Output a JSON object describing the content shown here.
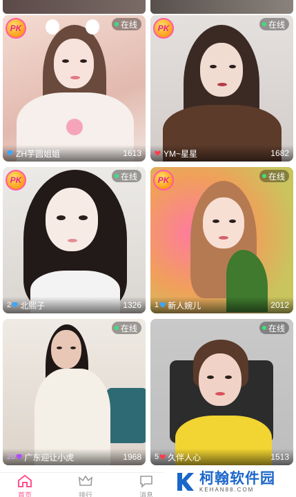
{
  "top_partial": {
    "left_text": "",
    "right_text": ""
  },
  "online_label": "在线",
  "pk_label": "PK",
  "cards": [
    {
      "name": "ZH芋圆姐姐",
      "level": "",
      "level_color": "#3aa7ff",
      "count": "1613",
      "pk": true,
      "bg": "#e7cdc6"
    },
    {
      "name": "YM~星星",
      "level": "",
      "level_color": "#ff3b4a",
      "count": "1682",
      "pk": true,
      "bg": "#d9d2cf"
    },
    {
      "name": "北熙子",
      "level": "2",
      "level_color": "#3aa7ff",
      "count": "1326",
      "pk": true,
      "bg": "#e9e6e2"
    },
    {
      "name": "新人婉儿",
      "level": "1",
      "level_color": "#3aa7ff",
      "count": "2012",
      "pk": true,
      "bg": "#f0a07a"
    },
    {
      "name": "广东迎让小虎",
      "level": "20",
      "level_color": "#b24dff",
      "count": "1968",
      "pk": false,
      "bg": "#e3dcd4"
    },
    {
      "name": "久伴人心",
      "level": "5",
      "level_color": "#ff3b4a",
      "count": "1513",
      "pk": false,
      "bg": "#cfcfcf"
    }
  ],
  "nav": [
    {
      "label": "首页",
      "icon": "home-icon"
    },
    {
      "label": "排行",
      "icon": "crown-icon"
    },
    {
      "label": "消息",
      "icon": "message-icon"
    }
  ],
  "watermark": {
    "cn": "柯翰软件园",
    "en": "KEHAN88.COM"
  }
}
